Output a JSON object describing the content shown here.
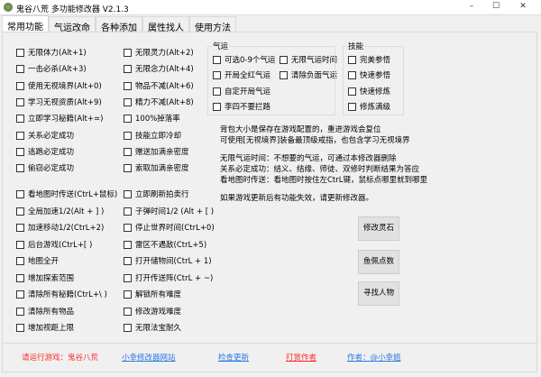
{
  "window": {
    "title": "鬼谷八荒 多功能修改器 V2.1.3",
    "minimize": "–",
    "maximize": "☐",
    "close": "✕"
  },
  "tabs": [
    "常用功能",
    "气运改命",
    "各种添加",
    "属性找人",
    "使用方法"
  ],
  "col1": [
    "无限体力(Alt+1)",
    "一击必杀(Alt+3)",
    "使用无视境界(Alt+0)",
    "学习无视资质(Alt+9)",
    "立即学习秘籍(Alt+=)",
    "关系必定成功",
    "逃跑必定成功",
    "偷窃必定成功"
  ],
  "col2": [
    "无限灵力(Alt+2)",
    "无限念力(Alt+4)",
    "物品不减(Alt+6)",
    "精力不减(Alt+8)",
    "100%掉落率",
    "技能立即冷却",
    "赠送加满亲密度",
    "索取加满亲密度"
  ],
  "col3": [
    "看地图时传送(CtrL+鼠标)",
    "全局加速1/2(Alt + ] )",
    "加速移动1/2(CtrL+2)",
    "后台游戏(CtrL+[ )",
    "地图全开",
    "增加探索范围",
    "清除所有秘籍(CtrL+\\ )",
    "清除所有物品",
    "增加视距上限"
  ],
  "col4": [
    "立即刷新拍卖行",
    "子弹时间1/2 (Alt + [ )",
    "停止世界时间(CtrL+0)",
    "雷区不遇敌(CtrL+5)",
    "打开储物间(CtrL + 1)",
    "打开传送阵(CtrL + ~)",
    "解锁所有难度",
    "修改游戏难度",
    "无限法宝耐久"
  ],
  "qiyun": {
    "label": "气运",
    "items": [
      "可选0-9个气运",
      "开局全红气运",
      "自定开局气运",
      "李四不要拦路",
      "无限气运时间",
      "清除负面气运"
    ]
  },
  "skill": {
    "label": "技能",
    "items": [
      "完美参悟",
      "快速参悟",
      "快速修炼",
      "修炼满级"
    ]
  },
  "info": [
    "背包大小是保存在游戏配置的，重进游戏会复位",
    "可使用[无视境界]装备最顶级戒指，也包含学习无视境界",
    "无限气运时间：不想要的气运，可通过本修改器删除",
    "关系必定成功：结义、结缘、师徒、双修时判断结果为答应",
    "看地图时传送：看地图时按住左CtrL键，鼠标点哪里就到哪里",
    "如果游戏更新后有功能失效，请更新修改器。"
  ],
  "buttons": [
    "修改灵石",
    "鱼佩点数",
    "寻找人物"
  ],
  "footer": {
    "status": "请运行游戏：鬼谷八荒",
    "site": "小幸修改器网站",
    "update": "检查更新",
    "donate": "打赏作者",
    "author": "作者：@小幸姐"
  },
  "colors": {
    "red": "#ff2a2a",
    "link": "#2a7ae2"
  }
}
